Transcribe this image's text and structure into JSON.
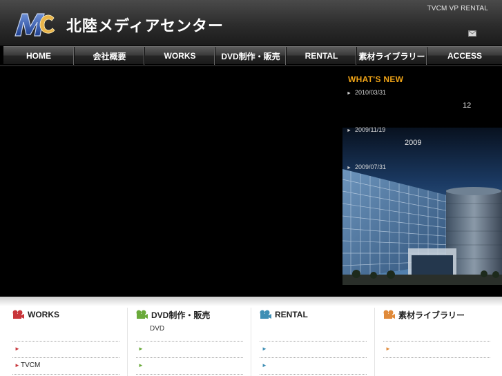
{
  "header": {
    "logo_text": "MC",
    "site_title": "北陸メディアセンター",
    "top_links": "TVCM VP RENTAL",
    "mail_icon": "mail-icon"
  },
  "nav": {
    "items": [
      {
        "label": "HOME"
      },
      {
        "label": "会社概要"
      },
      {
        "label": "WORKS"
      },
      {
        "label": "DVD制作・販売"
      },
      {
        "label": "RENTAL"
      },
      {
        "label": "素材ライブラリー"
      },
      {
        "label": "ACCESS"
      }
    ]
  },
  "news": {
    "title": "WHAT'S NEW",
    "items": [
      {
        "date": "2010/03/31",
        "text": "12"
      },
      {
        "date": "2009/11/19",
        "text": "2009"
      },
      {
        "date": "2009/07/31",
        "text": ""
      }
    ]
  },
  "columns": [
    {
      "title": "WORKS",
      "subtitle": "",
      "bullets": [
        "",
        "TVCM"
      ],
      "accent": "#c8363b",
      "icon": "video-camera-icon"
    },
    {
      "title": "DVD制作・販売",
      "subtitle": "DVD",
      "bullets": [
        "",
        ""
      ],
      "accent": "#6aaa3a",
      "icon": "video-camera-icon"
    },
    {
      "title": "RENTAL",
      "subtitle": "",
      "bullets": [
        "",
        ""
      ],
      "accent": "#3f8fb5",
      "icon": "video-camera-icon"
    },
    {
      "title": "素材ライブラリー",
      "subtitle": "",
      "bullets": [
        ""
      ],
      "accent": "#e08a3a",
      "icon": "video-camera-icon"
    }
  ],
  "colors": {
    "news_title": "#f0a417",
    "logo_blue": "#2a52a8"
  }
}
